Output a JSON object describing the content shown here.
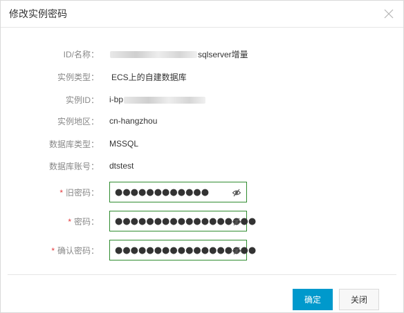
{
  "dialog": {
    "title": "修改实例密码",
    "close_icon": "close-icon"
  },
  "info": [
    {
      "label": "ID/名称：",
      "value": "sqlserver增量",
      "redacted_prefix": true
    },
    {
      "label": "实例类型：",
      "value": "ECS上的自建数据库"
    },
    {
      "label": "实例ID：",
      "value": "i-bp",
      "redacted_suffix": true
    },
    {
      "label": "实例地区：",
      "value": "cn-hangzhou"
    },
    {
      "label": "数据库类型：",
      "value": "MSSQL"
    },
    {
      "label": "数据库账号：",
      "value": "dtstest"
    }
  ],
  "password_fields": [
    {
      "required_mark": "*",
      "label": "旧密码：",
      "masked_value": "●●●●●●●●●●●●",
      "eye_icon": "eye-slash-icon"
    },
    {
      "required_mark": "*",
      "label": "密码：",
      "masked_value": "●●●●●●●●●●●●●●●●●●",
      "eye_icon": "eye-slash-icon"
    },
    {
      "required_mark": "*",
      "label": "确认密码：",
      "masked_value": "●●●●●●●●●●●●●●●●●●",
      "eye_icon": "eye-slash-icon"
    }
  ],
  "footer": {
    "confirm_label": "确定",
    "close_label": "关闭"
  },
  "colors": {
    "primary_button": "#0099cc",
    "input_border": "#2e8b2e",
    "required": "#e4393c"
  }
}
